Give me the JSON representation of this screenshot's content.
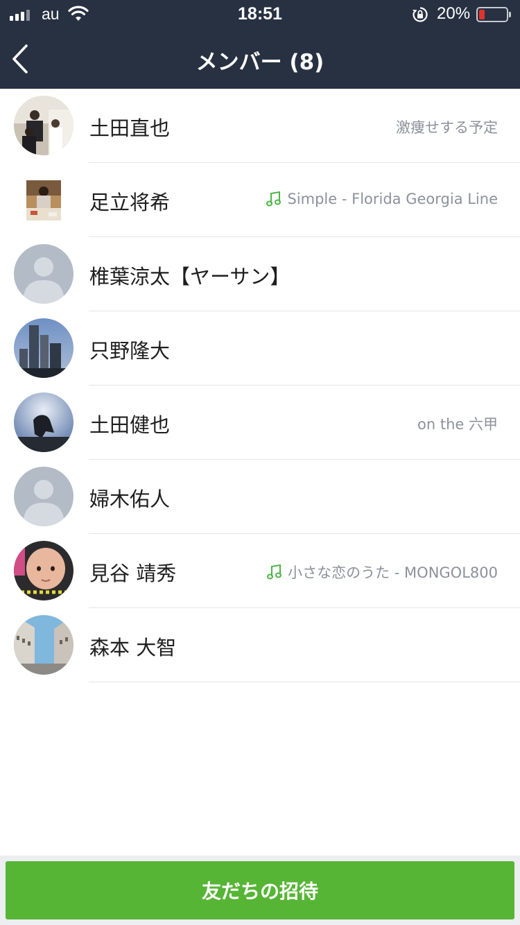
{
  "status_bar": {
    "carrier": "au",
    "time": "18:51",
    "battery_percent": "20%",
    "battery_level": 0.2,
    "icons": [
      "signal-icon",
      "wifi-icon",
      "rotation-lock-icon",
      "battery-icon"
    ]
  },
  "header": {
    "title": "メンバー (8)",
    "back_icon": "chevron-left-icon"
  },
  "members": [
    {
      "name": "土田直也",
      "status": "激痩せする予定",
      "music": false,
      "avatar": "photo"
    },
    {
      "name": "足立将希",
      "status": "Simple - Florida Georgia Line",
      "music": true,
      "avatar": "photo-square"
    },
    {
      "name": "椎葉涼太【ヤーサン】",
      "status": "",
      "music": false,
      "avatar": "default"
    },
    {
      "name": "只野隆大",
      "status": "",
      "music": false,
      "avatar": "photo"
    },
    {
      "name": "土田健也",
      "status": "on the 六甲",
      "music": false,
      "avatar": "photo"
    },
    {
      "name": "婦木佑人",
      "status": "",
      "music": false,
      "avatar": "default"
    },
    {
      "name": "見谷 靖秀",
      "status": "小さな恋のうた - MONGOL800",
      "music": true,
      "avatar": "photo"
    },
    {
      "name": "森本 大智",
      "status": "",
      "music": false,
      "avatar": "photo"
    }
  ],
  "invite_button": {
    "label": "友だちの招待"
  },
  "colors": {
    "header_bg": "#283142",
    "accent_green": "#57b535",
    "music_icon": "#4cb548",
    "status_text": "#8b919b",
    "battery_low": "#e0332e"
  }
}
